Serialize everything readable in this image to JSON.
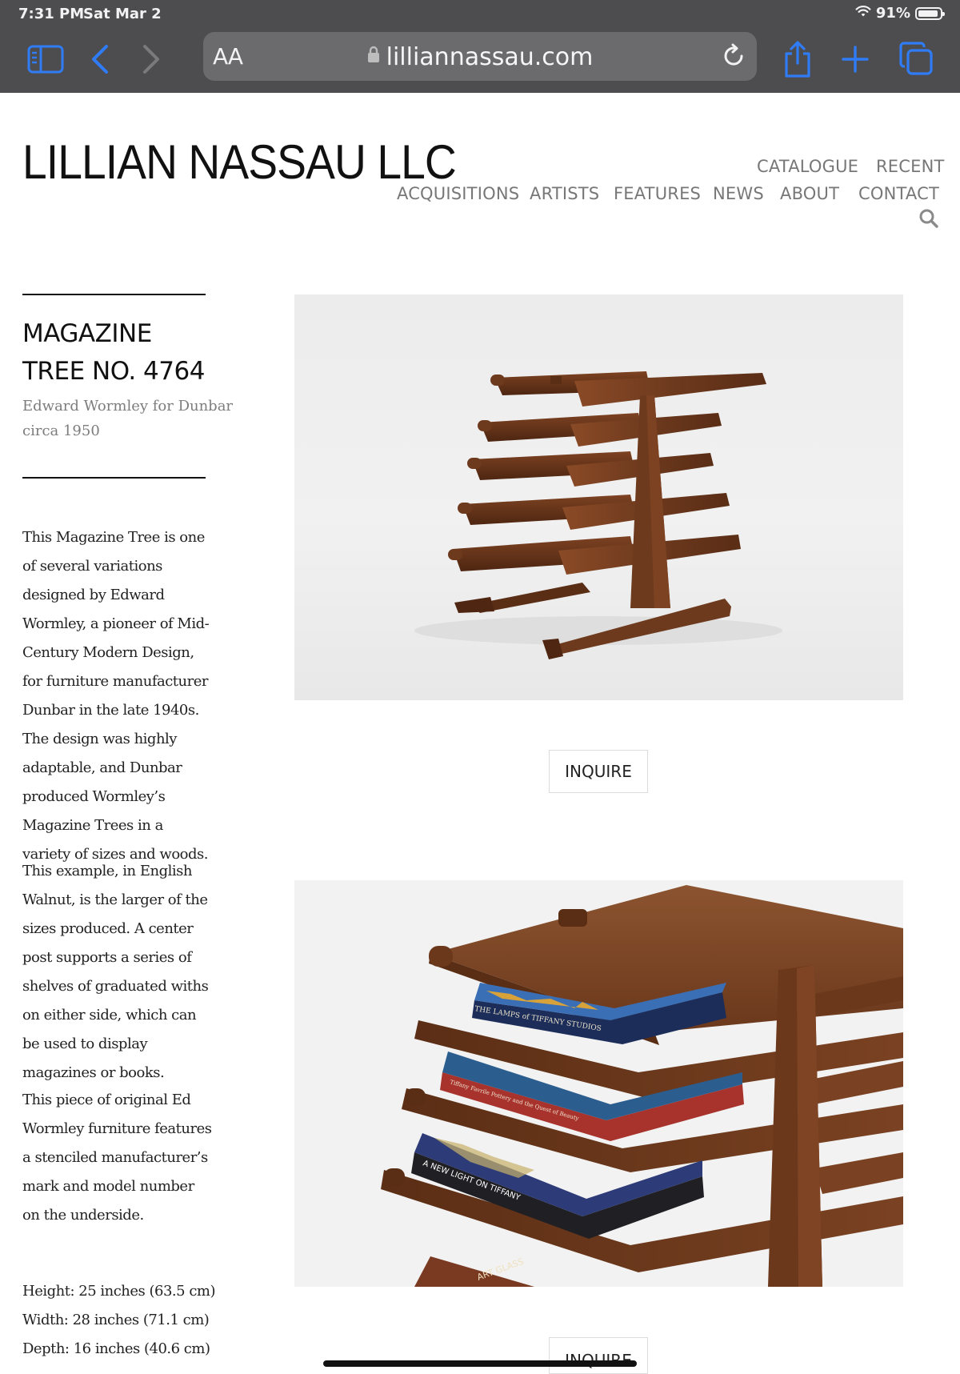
{
  "status_bar": {
    "time": "7:31 PM",
    "date": "Sat Mar 2",
    "battery": "91%",
    "battery_level": 0.91
  },
  "browser": {
    "aa_label": "AA",
    "url": "lilliannassau.com"
  },
  "site": {
    "logo": "LILLIAN NASSAU LLC",
    "nav": [
      "CATALOGUE",
      "RECENT",
      "ACQUISITIONS",
      "ARTISTS",
      "FEATURES",
      "NEWS",
      "ABOUT",
      "CONTACT"
    ]
  },
  "item": {
    "title_line1": "MAGAZINE",
    "title_line2": "TREE NO. 4764",
    "designer": "Edward Wormley for Dunbar",
    "date": "circa 1950",
    "paragraphs": [
      "This Magazine Tree is one of several variations designed by Edward Wormley, a pioneer of Mid-Century Modern Design, for furniture manufacturer Dunbar in the late 1940s. The design was highly adaptable, and Dunbar produced Wormley’s Magazine Trees in a variety of sizes and woods.",
      "This example, in English Walnut, is the larger of the sizes produced. A center post supports a series of shelves of graduated withs on either side, which can be used to display magazines or books.",
      "This piece of original Ed Wormley furniture features a stenciled manufacturer’s mark and model number on the underside."
    ],
    "height": "Height: 25 inches (63.5 cm)",
    "width": "Width: 28 inches (71.1 cm)",
    "depth": "Depth: 16 inches (40.6 cm)"
  },
  "actions": {
    "inquire_label": "INQUIRE",
    "inquire_label_2": "INQUIRE"
  },
  "book_spines": {
    "book1": "THE LAMPS of TIFFANY STUDIOS",
    "book2": "Tiffany Favrile Pottery and the Quest of Beauty",
    "book3": "A NEW LIGHT ON TIFFANY",
    "book4": "ART GLASS"
  },
  "colors": {
    "chrome": "#4d4d4f",
    "url_field": "#6b6b6e",
    "ios_blue": "#2f7cf6",
    "walnut": "#6e3a1e",
    "nav_text": "#777777"
  },
  "icons": [
    "sidebar-icon",
    "back-icon",
    "forward-icon",
    "lock-icon",
    "reload-icon",
    "share-icon",
    "new-tab-icon",
    "tabs-icon",
    "wifi-icon",
    "battery-icon",
    "search-icon"
  ]
}
